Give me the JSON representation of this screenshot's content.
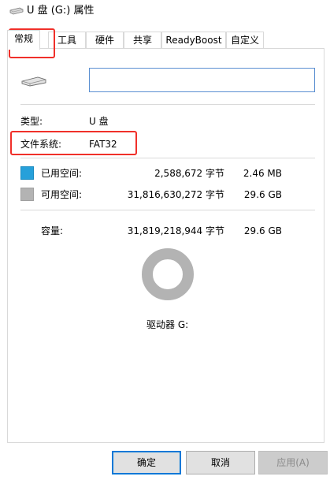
{
  "window": {
    "title": "U 盘 (G:) 属性",
    "icon": "usb-drive-icon"
  },
  "tabs": [
    {
      "label": "常规",
      "active": true
    },
    {
      "label": "工具",
      "active": false
    },
    {
      "label": "硬件",
      "active": false
    },
    {
      "label": "共享",
      "active": false
    },
    {
      "label": "ReadyBoost",
      "active": false
    },
    {
      "label": "自定义",
      "active": false
    }
  ],
  "general": {
    "drive_icon": "usb-drive-icon",
    "volume_label_value": "",
    "type_label": "类型:",
    "type_value": "U 盘",
    "filesystem_label": "文件系统:",
    "filesystem_value": "FAT32",
    "used": {
      "label": "已用空间:",
      "bytes": "2,588,672 字节",
      "size": "2.46 MB",
      "color": "#26a0da"
    },
    "free": {
      "label": "可用空间:",
      "bytes": "31,816,630,272 字节",
      "size": "29.6 GB",
      "color": "#b3b3b3"
    },
    "capacity": {
      "label": "容量:",
      "bytes": "31,819,218,944 字节",
      "size": "29.6 GB"
    },
    "used_fraction": 8.14e-05,
    "drive_label": "驱动器 G:"
  },
  "buttons": {
    "ok": "确定",
    "cancel": "取消",
    "apply": "应用(A)"
  },
  "annotation_color": "#f0302a"
}
